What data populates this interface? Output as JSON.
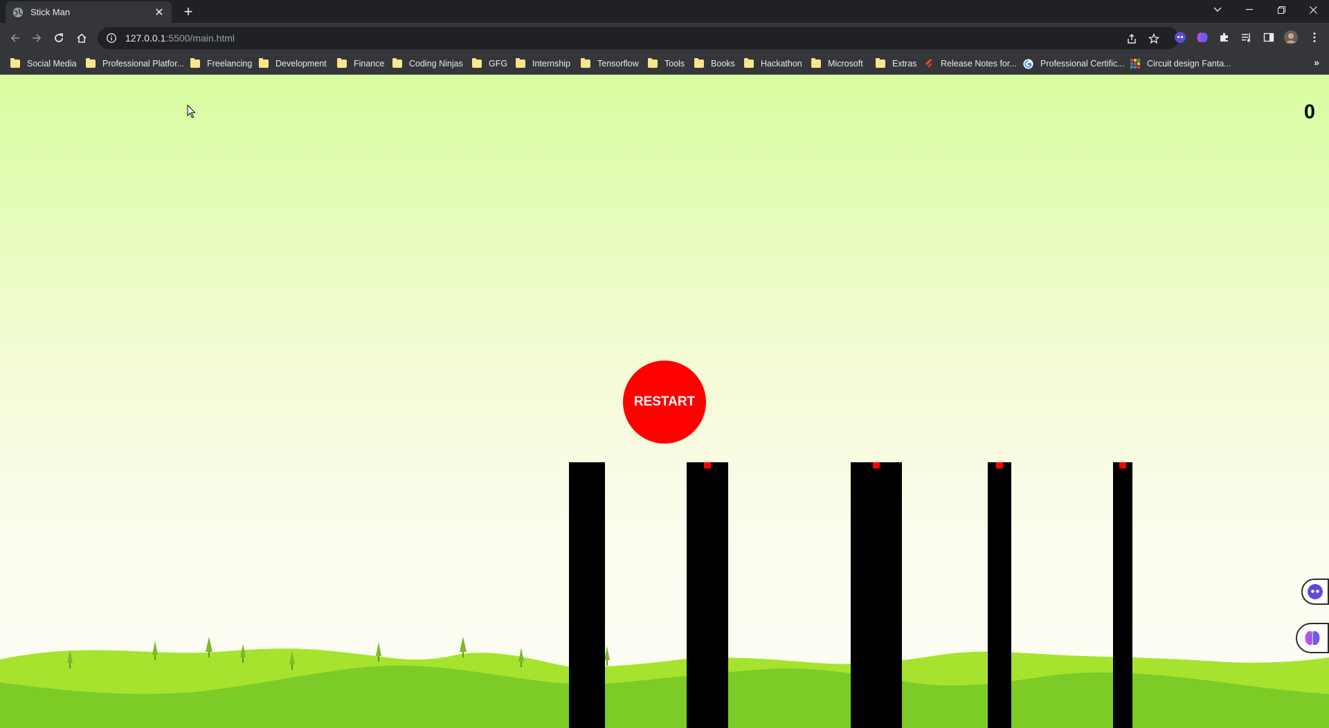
{
  "browser": {
    "tab": {
      "title": "Stick Man",
      "favicon": "globe-icon"
    },
    "window_controls": [
      "tab-search-icon",
      "minimize-icon",
      "restore-icon",
      "close-icon"
    ],
    "url": {
      "host": "127.0.0.1",
      "path": ":5500/main.html"
    },
    "bookmarks": [
      {
        "label": "Social Media",
        "icon": "folder-icon"
      },
      {
        "label": "Professional Platfor...",
        "icon": "folder-icon"
      },
      {
        "label": "Freelancing",
        "icon": "folder-icon"
      },
      {
        "label": "Development",
        "icon": "folder-icon"
      },
      {
        "label": "Finance",
        "icon": "folder-icon"
      },
      {
        "label": "Coding Ninjas",
        "icon": "folder-icon"
      },
      {
        "label": "GFG",
        "icon": "folder-icon"
      },
      {
        "label": "Internship",
        "icon": "folder-icon"
      },
      {
        "label": "Tensorflow",
        "icon": "folder-icon"
      },
      {
        "label": "Tools",
        "icon": "folder-icon"
      },
      {
        "label": "Books",
        "icon": "folder-icon"
      },
      {
        "label": "Hackathon",
        "icon": "folder-icon"
      },
      {
        "label": "Microsoft",
        "icon": "folder-icon"
      },
      {
        "label": "Extras",
        "icon": "folder-icon"
      },
      {
        "label": "Release Notes for...",
        "icon": "flutter-icon"
      },
      {
        "label": "Professional Certific...",
        "icon": "google-icon"
      },
      {
        "label": "Circuit design Fanta...",
        "icon": "tinkercad-icon"
      }
    ],
    "more_bookmarks": "»"
  },
  "game": {
    "score": "0",
    "restart_label": "RESTART",
    "colors": {
      "sky_top": "#d9fda0",
      "sky_bottom": "#fdfdf5",
      "hill_light": "#a5e32f",
      "hill_dark": "#7ccb26",
      "platform": "#000000",
      "restart": "#ff0000",
      "target": "#ff0000"
    }
  }
}
